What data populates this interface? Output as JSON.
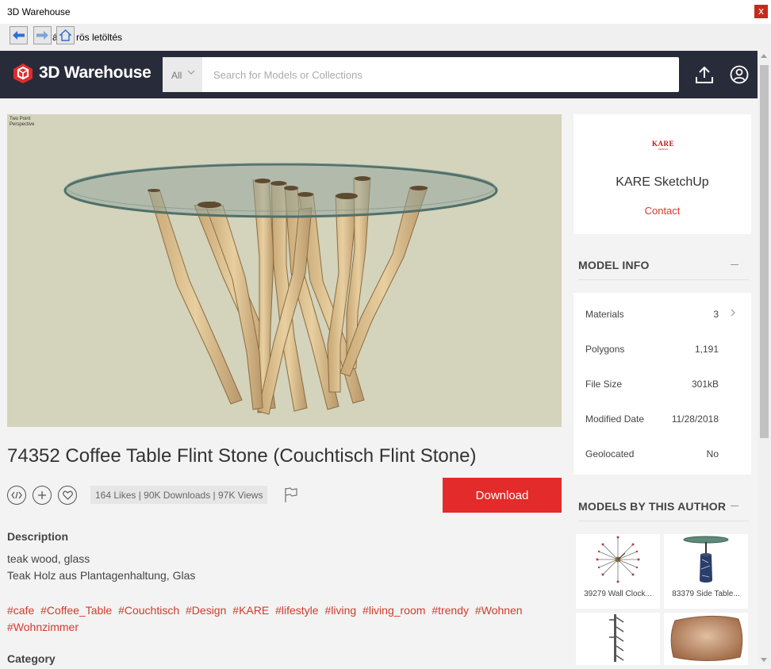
{
  "window": {
    "title": "3D Warehouse",
    "close_label": "x"
  },
  "browser_nav": {
    "status_text": "rös letöltés",
    "overlay_char": "á"
  },
  "header": {
    "logo_text": "3D Warehouse",
    "search_category": "All",
    "search_placeholder": "Search for Models or Collections"
  },
  "viewer": {
    "perspective_label": "Two Point Perspective"
  },
  "model": {
    "title": "74352 Coffee Table Flint Stone (Couchtisch Flint Stone)",
    "stats": "164 Likes | 90K Downloads | 97K Views",
    "download_label": "Download",
    "description_heading": "Description",
    "description_lines": [
      "teak wood, glass",
      "Teak Holz aus Plantagenhaltung, Glas"
    ],
    "tags": [
      "#cafe",
      "#Coffee_Table",
      "#Couchtisch",
      "#Design",
      "#KARE",
      "#lifestyle",
      "#living",
      "#living_room",
      "#trendy",
      "#Wohnen",
      "#Wohnzimmer"
    ],
    "category_heading": "Category"
  },
  "author": {
    "logo_text": "KARE",
    "logo_subtext": "DESIGN",
    "name": "KARE SketchUp",
    "contact_label": "Contact"
  },
  "model_info": {
    "heading": "MODEL INFO",
    "rows": [
      {
        "label": "Materials",
        "value": "3"
      },
      {
        "label": "Polygons",
        "value": "1,191"
      },
      {
        "label": "File Size",
        "value": "301kB"
      },
      {
        "label": "Modified Date",
        "value": "11/28/2018"
      },
      {
        "label": "Geolocated",
        "value": "No"
      }
    ]
  },
  "author_models": {
    "heading": "MODELS BY THIS AUTHOR",
    "items": [
      {
        "caption": "39279 Wall Clock..."
      },
      {
        "caption": "83379 Side Table..."
      },
      {
        "caption": ""
      },
      {
        "caption": ""
      }
    ]
  },
  "colors": {
    "header_bg": "#282c3a",
    "accent_red": "#e32b2b",
    "tag_red": "#d8382e",
    "viewer_bg": "#d4d3bb"
  },
  "icons": {
    "nav_back": "arrow-left-icon",
    "nav_forward": "arrow-right-icon",
    "nav_home": "home-icon",
    "upload": "upload-icon",
    "account": "user-circle-icon",
    "embed": "embed-code-icon",
    "add": "plus-icon",
    "like": "heart-icon",
    "report": "flag-icon"
  }
}
